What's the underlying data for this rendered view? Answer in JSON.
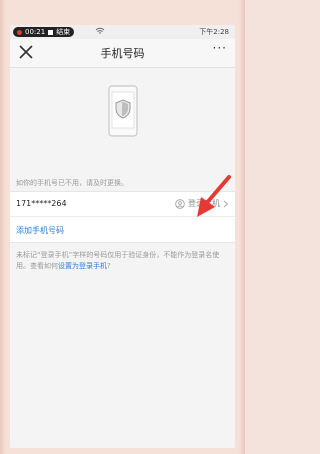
{
  "status": {
    "record_time": "00:21",
    "end_label": "结束",
    "clock": "下午2:28"
  },
  "nav": {
    "title": "手机号码",
    "more": "···"
  },
  "hint": "如你的手机号已不用，请及时更换。",
  "phone": {
    "number": "171*****264",
    "login_label": "登录手机"
  },
  "add_phone": "添加手机号码",
  "note": {
    "text": "未标记“登录手机”字样的号码仅用于验证身份，不能作为登录名使用。查看如何",
    "link": "设置为登录手机",
    "end": "?"
  },
  "colors": {
    "accent": "#2f7bd6",
    "arrow": "#e53935"
  },
  "icons": [
    "close-icon",
    "more-icon",
    "phone-shield-icon",
    "user-icon",
    "chevron-right-icon"
  ]
}
